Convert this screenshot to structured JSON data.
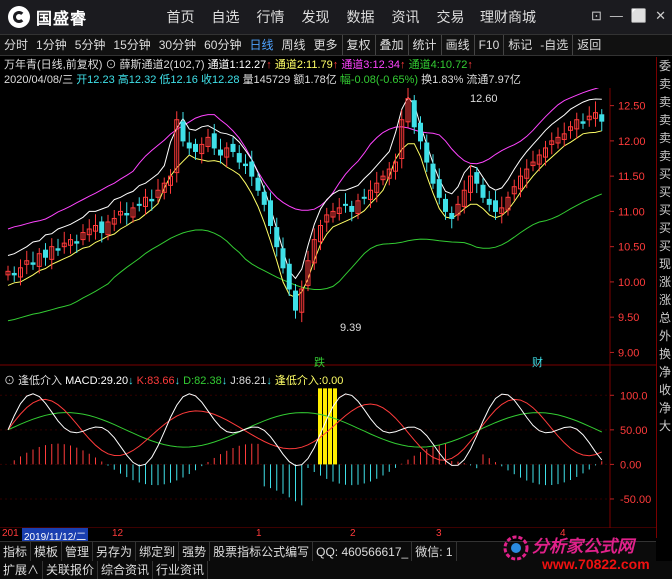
{
  "app": {
    "logo_text": "国盛睿",
    "nav": [
      "首页",
      "自选",
      "行情",
      "发现",
      "数据",
      "资讯",
      "交易",
      "理财商城"
    ],
    "window_controls": [
      "⊡",
      "—",
      "⬜",
      "✕"
    ]
  },
  "toolbar": {
    "periods": [
      "分时",
      "1分钟",
      "5分钟",
      "15分钟",
      "30分钟",
      "60分钟",
      "日线",
      "周线",
      "更多"
    ],
    "active_period": "日线",
    "tools": [
      "复权",
      "叠加",
      "统计",
      "画线",
      "F10",
      "标记",
      "-自选",
      "返回"
    ]
  },
  "quote": {
    "stock": "万年青(日线,前复权)",
    "indicator": "薛斯通道2(102,7)",
    "ch1_label": "通道1:",
    "ch1": "12.27",
    "ch2_label": "通道2:",
    "ch2": "11.79",
    "ch3_label": "通道3:",
    "ch3": "12.34",
    "ch4_label": "通道4:",
    "ch4": "10.72",
    "date": "2020/04/08/三",
    "open": "开12.23",
    "high": "高12.32",
    "low": "低12.16",
    "close": "收12.28",
    "volume": "量145729",
    "amount": "额1.78亿",
    "change": "幅-0.08(-0.65%)",
    "turnover": "换1.83%",
    "float": "流通7.97亿"
  },
  "price_axis": [
    "12.50",
    "12.00",
    "11.50",
    "11.00",
    "10.50",
    "10.00",
    "9.50",
    "9.00"
  ],
  "price_high_label": "12.60",
  "price_low_label": "9.39",
  "markers": {
    "die": "跌",
    "cai": "财"
  },
  "macd_line": {
    "name": "逢低介入",
    "macd_label": "MACD:",
    "macd": "29.20",
    "k_label": "K:",
    "k": "83.66",
    "d_label": "D:",
    "d": "82.38",
    "j_label": "J:",
    "j": "86.21",
    "signal_label": "逢低介入:",
    "signal": "0.00"
  },
  "macd_axis": [
    "100.0",
    "50.00",
    "0.00",
    "-50.00"
  ],
  "date_axis": {
    "left": "201",
    "selected": "2019/11/12/二",
    "ticks": [
      "12",
      "1",
      "2",
      "3",
      "4"
    ]
  },
  "right_panel": [
    "委",
    "卖",
    "卖",
    "卖",
    "卖",
    "卖",
    "买",
    "买",
    "买",
    "买",
    "买",
    "现",
    "涨",
    "涨",
    "总",
    "外",
    "换",
    "净",
    "收",
    "净",
    "大"
  ],
  "bottom_row1": [
    "指标",
    "模板",
    "管理",
    "另存为",
    "绑定到",
    "强势",
    "股票指标公式编写",
    "QQ: 460566617_",
    "微信: 1"
  ],
  "bottom_row2": [
    "扩展∧",
    "关联报价",
    "综合资讯",
    "行业资讯"
  ],
  "watermark": {
    "title": "分析家公式网",
    "url": "www.70822.com"
  },
  "colors": {
    "up": "#ff3b3b",
    "down": "#3fe0e8",
    "ch3": "#ff44ff",
    "ch4": "#33cc33",
    "ch1": "#ffffff",
    "ch2": "#ffff66",
    "accent": "#4fa3ff"
  }
}
